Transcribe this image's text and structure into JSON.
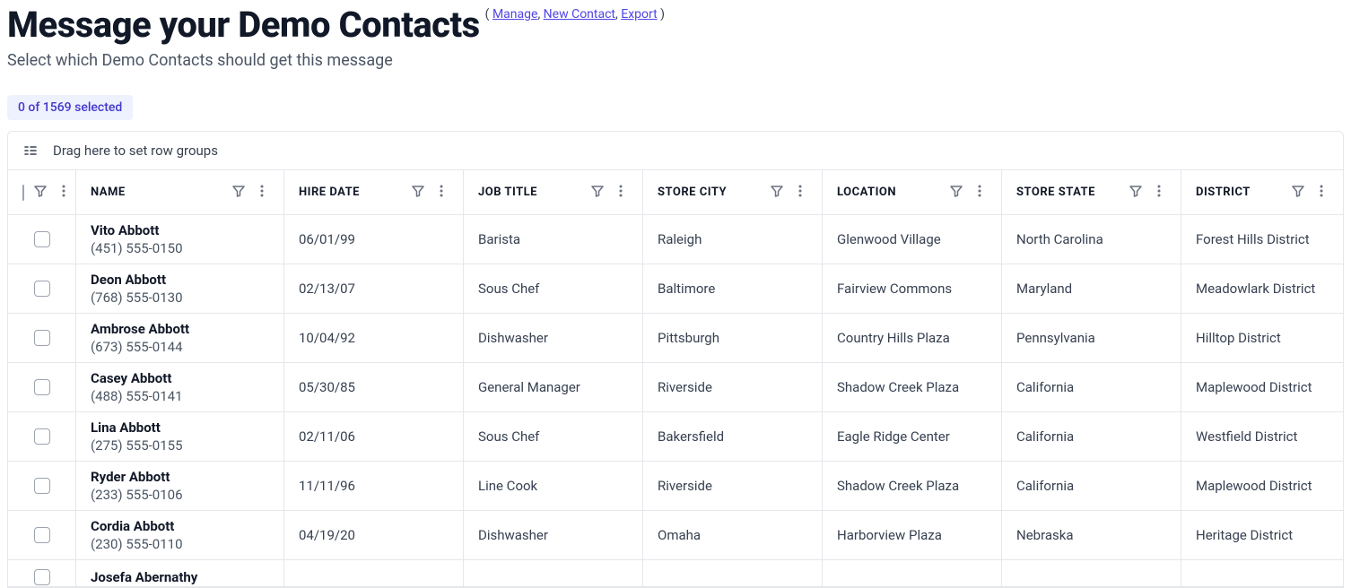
{
  "header": {
    "title": "Message your Demo Contacts",
    "links_open": "(",
    "links": [
      {
        "label": "Manage"
      },
      {
        "label": "New Contact"
      },
      {
        "label": "Export"
      }
    ],
    "links_sep": ", ",
    "links_close": ")",
    "subtitle": "Select which Demo Contacts should get this message"
  },
  "selected_badge": "0 of 1569 selected",
  "group_drop_hint": "Drag here to set row groups",
  "columns": {
    "name": "NAME",
    "hire": "HIRE DATE",
    "job": "JOB TITLE",
    "city": "STORE CITY",
    "loc": "LOCATION",
    "state": "STORE STATE",
    "dist": "DISTRICT"
  },
  "rows": [
    {
      "name": "Vito Abbott",
      "phone": "(451) 555-0150",
      "hire": "06/01/99",
      "job": "Barista",
      "city": "Raleigh",
      "loc": "Glenwood Village",
      "state": "North Carolina",
      "dist": "Forest Hills District"
    },
    {
      "name": "Deon Abbott",
      "phone": "(768) 555-0130",
      "hire": "02/13/07",
      "job": "Sous Chef",
      "city": "Baltimore",
      "loc": "Fairview Commons",
      "state": "Maryland",
      "dist": "Meadowlark District"
    },
    {
      "name": "Ambrose Abbott",
      "phone": "(673) 555-0144",
      "hire": "10/04/92",
      "job": "Dishwasher",
      "city": "Pittsburgh",
      "loc": "Country Hills Plaza",
      "state": "Pennsylvania",
      "dist": "Hilltop District"
    },
    {
      "name": "Casey Abbott",
      "phone": "(488) 555-0141",
      "hire": "05/30/85",
      "job": "General Manager",
      "city": "Riverside",
      "loc": "Shadow Creek Plaza",
      "state": "California",
      "dist": "Maplewood District"
    },
    {
      "name": "Lina Abbott",
      "phone": "(275) 555-0155",
      "hire": "02/11/06",
      "job": "Sous Chef",
      "city": "Bakersfield",
      "loc": "Eagle Ridge Center",
      "state": "California",
      "dist": "Westfield District"
    },
    {
      "name": "Ryder Abbott",
      "phone": "(233) 555-0106",
      "hire": "11/11/96",
      "job": "Line Cook",
      "city": "Riverside",
      "loc": "Shadow Creek Plaza",
      "state": "California",
      "dist": "Maplewood District"
    },
    {
      "name": "Cordia Abbott",
      "phone": "(230) 555-0110",
      "hire": "04/19/20",
      "job": "Dishwasher",
      "city": "Omaha",
      "loc": "Harborview Plaza",
      "state": "Nebraska",
      "dist": "Heritage District"
    }
  ],
  "partial_row": {
    "name": "Josefa Abernathy"
  }
}
